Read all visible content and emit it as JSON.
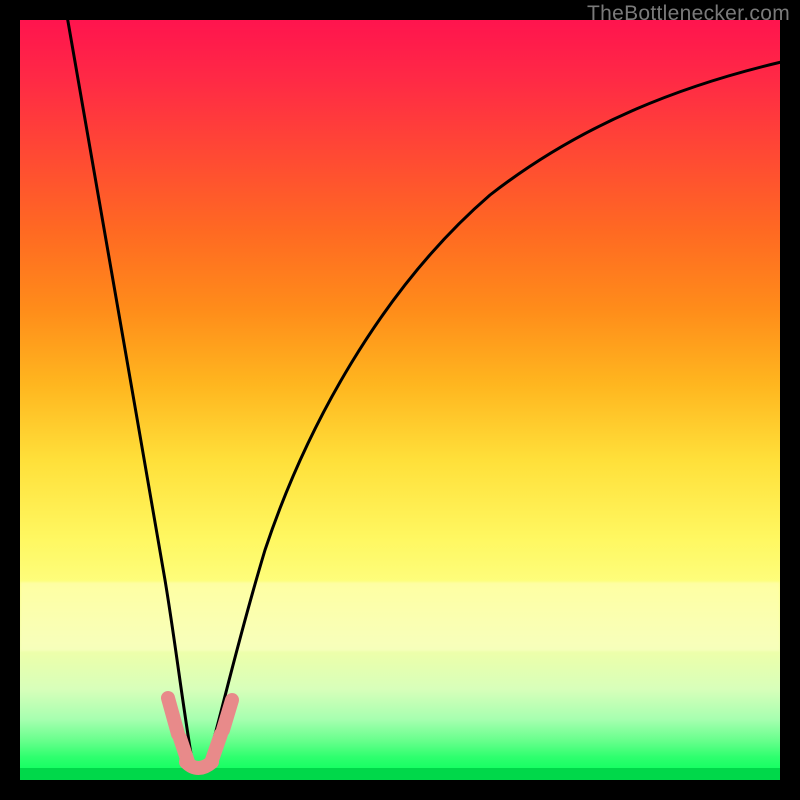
{
  "watermark": "TheBottlenecker.com",
  "chart_data": {
    "type": "line",
    "title": "",
    "xlabel": "",
    "ylabel": "",
    "xlim": [
      0,
      100
    ],
    "ylim": [
      0,
      100
    ],
    "grid": false,
    "series": [
      {
        "name": "curve-left",
        "x": [
          5,
          8,
          12,
          16,
          19,
          21,
          22
        ],
        "y": [
          100,
          80,
          55,
          30,
          12,
          3,
          0
        ]
      },
      {
        "name": "curve-right",
        "x": [
          22,
          24,
          27,
          32,
          40,
          50,
          62,
          78,
          100
        ],
        "y": [
          0,
          4,
          14,
          32,
          52,
          68,
          79,
          87,
          93
        ]
      },
      {
        "name": "notch-highlight",
        "x": [
          19,
          20,
          21,
          22,
          23,
          24,
          25,
          26
        ],
        "y": [
          4,
          2,
          1,
          0,
          0,
          1,
          2,
          4
        ]
      }
    ],
    "gradient_stops": [
      {
        "pos": 0,
        "color": "#ff144e"
      },
      {
        "pos": 50,
        "color": "#ffd83a"
      },
      {
        "pos": 75,
        "color": "#fdff80"
      },
      {
        "pos": 100,
        "color": "#00ff58"
      }
    ]
  }
}
